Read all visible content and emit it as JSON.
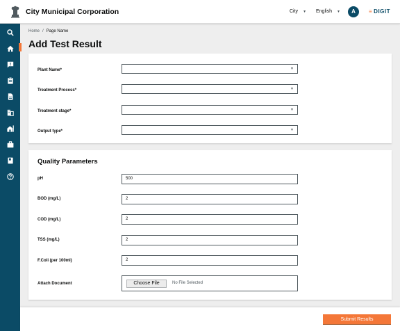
{
  "header": {
    "title": "City Municipal Corporation",
    "city_label": "City",
    "language_label": "English",
    "avatar_initial": "A",
    "logo_text": "DIGIT"
  },
  "sidebar": {
    "items": [
      {
        "icon": "search-icon"
      },
      {
        "icon": "home-icon",
        "active": true
      },
      {
        "icon": "complaint-icon"
      },
      {
        "icon": "clipboard-icon"
      },
      {
        "icon": "document-icon"
      },
      {
        "icon": "building-icon"
      },
      {
        "icon": "property-icon"
      },
      {
        "icon": "briefcase-icon"
      },
      {
        "icon": "book-icon"
      },
      {
        "icon": "help-icon"
      }
    ]
  },
  "breadcrumb": {
    "home": "Home",
    "separator": "/",
    "current": "Page Name"
  },
  "page_title": "Add Test Result",
  "form": {
    "plant_name_label": "Plant Name*",
    "treatment_process_label": "Treatment Process*",
    "treatment_stage_label": "Treatment stage*",
    "output_type_label": "Output type*"
  },
  "quality": {
    "title": "Quality Parameters",
    "ph": {
      "label": "pH",
      "value": "500"
    },
    "bod": {
      "label": "BOD (mg/L)",
      "value": "2"
    },
    "cod": {
      "label": "COD (mg/L)",
      "value": "2"
    },
    "tss": {
      "label": "TSS (mg/L)",
      "value": "2"
    },
    "ecoli": {
      "label": "F.Coli (per 100ml)",
      "value": "2"
    },
    "attach": {
      "label": "Attach Document",
      "button": "Choose File",
      "status": "No File Selected"
    }
  },
  "footer": {
    "submit_label": "Submit Results"
  },
  "colors": {
    "primary": "#f47738",
    "sidebar": "#0b4b66",
    "background": "#eeeeee"
  }
}
